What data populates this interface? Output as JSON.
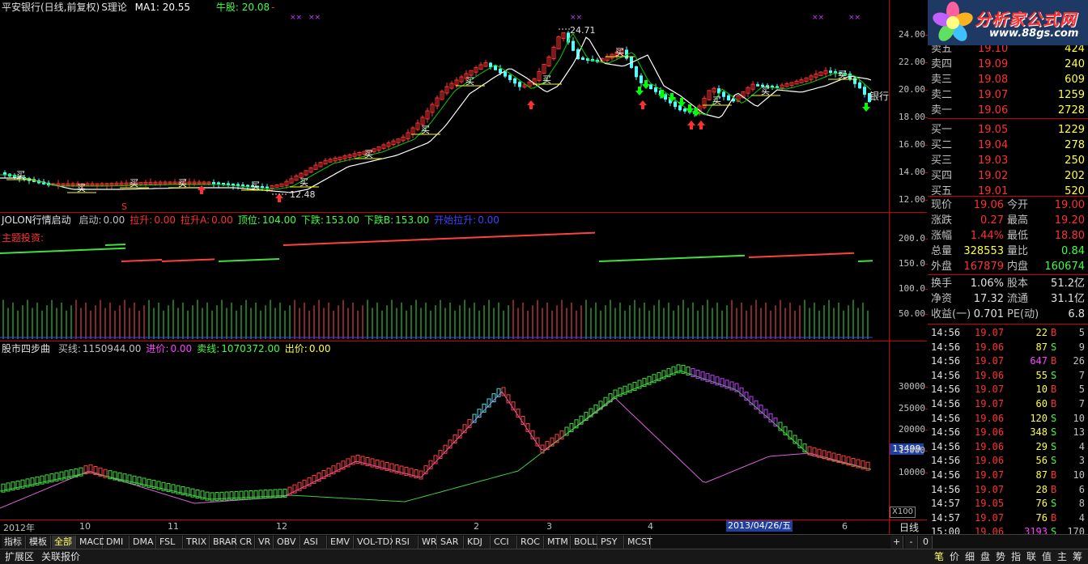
{
  "main_chart": {
    "title": "平安银行(日线,前复权)",
    "theory": "S理论",
    "ma1": "MA1: 20.55",
    "bull": "牛股: 20.08",
    "bull_suffix": "-",
    "high_label": "24.71",
    "low_label": "12.48",
    "side_label": "银行",
    "buy_marker": "买",
    "s_marker": "S",
    "axis_ticks": [
      "24.00",
      "22.00",
      "20.00",
      "18.00",
      "16.00",
      "14.00",
      "12.00"
    ],
    "colors": {
      "up": "#ff3232",
      "down": "#54fcfc",
      "ma": "#ffffff",
      "ma2": "#00cc00",
      "buy": "#ffff00",
      "arrow_up": "#ff3030",
      "arrow_down": "#00ff00"
    }
  },
  "indicator1": {
    "name": "JOLON行情启动",
    "fields": [
      {
        "label": "启动:",
        "value": "0.00",
        "color": "#c0c0c0"
      },
      {
        "label": "拉升:",
        "value": "0.00",
        "color": "#ff3030"
      },
      {
        "label": "拉升A:",
        "value": "0.00",
        "color": "#ff3030"
      },
      {
        "label": "顶位:",
        "value": "104.00",
        "color": "#40ff40"
      },
      {
        "label": "下跌:",
        "value": "153.00",
        "color": "#40ff40"
      },
      {
        "label": "下跌B:",
        "value": "153.00",
        "color": "#40ff40"
      },
      {
        "label": "开始拉升:",
        "value": "0.00",
        "color": "#4040ff"
      }
    ],
    "sub_label": "主题投资:",
    "axis_ticks": [
      "200.0",
      "150.0",
      "100.0",
      "50.00"
    ]
  },
  "indicator2": {
    "name": "股市四步曲",
    "fields": [
      {
        "label": "买线:",
        "value": "1150944.00",
        "color": "#c0c0c0"
      },
      {
        "label": "进价:",
        "value": "0.00",
        "color": "#ff40ff"
      },
      {
        "label": "卖线:",
        "value": "1070372.00",
        "color": "#40ff40"
      },
      {
        "label": "出价:",
        "value": "0.00",
        "color": "#ffff40"
      }
    ],
    "axis_ticks": [
      "30000",
      "25000",
      "20000",
      "15000",
      "10000"
    ],
    "current_value": "13499",
    "scale": "X100"
  },
  "x_axis": {
    "labels": [
      "2012年",
      "10",
      "11",
      "12",
      "2",
      "3",
      "4",
      "6"
    ],
    "highlight": "2013/04/26/五",
    "period": "日线"
  },
  "tabs": [
    "指标",
    "模板",
    "全部",
    "MACD",
    "DMI",
    "DMA",
    "FSL",
    "TRIX",
    "BRAR",
    "CR",
    "VR",
    "OBV",
    "ASI",
    "EMV",
    "VOL-TDX",
    "RSI",
    "WR",
    "SAR",
    "KDJ",
    "CCI",
    "ROC",
    "MTM",
    "BOLL",
    "PSY",
    "MCST"
  ],
  "tab_controls": [
    "+",
    "-",
    "0"
  ],
  "bottom_tabs": [
    "扩展区",
    "关联报价"
  ],
  "bottom_right_tabs": [
    "笔",
    "价",
    "细",
    "盘",
    "势",
    "指",
    "联",
    "值",
    "主",
    "筹"
  ],
  "logo": {
    "text": "分析家公式网",
    "url": "www.88gs.com"
  },
  "order_book": {
    "sell": [
      {
        "label": "卖五",
        "price": "19.10",
        "vol": "424"
      },
      {
        "label": "卖四",
        "price": "19.09",
        "vol": "240"
      },
      {
        "label": "卖三",
        "price": "19.08",
        "vol": "609"
      },
      {
        "label": "卖二",
        "price": "19.07",
        "vol": "1259"
      },
      {
        "label": "卖一",
        "price": "19.06",
        "vol": "2728"
      }
    ],
    "buy": [
      {
        "label": "买一",
        "price": "19.05",
        "vol": "1229"
      },
      {
        "label": "买二",
        "price": "19.04",
        "vol": "278"
      },
      {
        "label": "买三",
        "price": "19.03",
        "vol": "250"
      },
      {
        "label": "买四",
        "price": "19.02",
        "vol": "202"
      },
      {
        "label": "买五",
        "price": "19.01",
        "vol": "520"
      }
    ]
  },
  "quote": [
    {
      "l1": "现价",
      "v1": "19.06",
      "c1": "#ff3030",
      "l2": "今开",
      "v2": "19.00",
      "c2": "#ff3030"
    },
    {
      "l1": "涨跌",
      "v1": "0.27",
      "c1": "#ff3030",
      "l2": "最高",
      "v2": "19.20",
      "c2": "#ff3030"
    },
    {
      "l1": "涨幅",
      "v1": "1.44%",
      "c1": "#ff3030",
      "l2": "最低",
      "v2": "18.80",
      "c2": "#ff3030"
    },
    {
      "l1": "总量",
      "v1": "328553",
      "c1": "#ffff40",
      "l2": "量比",
      "v2": "0.84",
      "c2": "#40ff40"
    },
    {
      "l1": "外盘",
      "v1": "167879",
      "c1": "#ff3030",
      "l2": "内盘",
      "v2": "160674",
      "c2": "#40ff40"
    }
  ],
  "fundamentals": [
    {
      "l1": "换手",
      "v1": "1.06%",
      "l2": "股本",
      "v2": "51.2亿"
    },
    {
      "l1": "净资",
      "v1": "17.32",
      "l2": "流通",
      "v2": "31.1亿"
    },
    {
      "l1": "收益(一)",
      "v1": "0.701",
      "l2": "PE(动)",
      "v2": "6.8"
    }
  ],
  "ticks": [
    {
      "time": "14:56",
      "price": "19.07",
      "vol": "22",
      "bs": "B",
      "n": "5",
      "vc": "#ffff40"
    },
    {
      "time": "14:56",
      "price": "19.06",
      "vol": "87",
      "bs": "S",
      "n": "9",
      "vc": "#ffff40"
    },
    {
      "time": "14:56",
      "price": "19.07",
      "vol": "647",
      "bs": "B",
      "n": "26",
      "vc": "#ff40ff"
    },
    {
      "time": "14:56",
      "price": "19.06",
      "vol": "55",
      "bs": "S",
      "n": "7",
      "vc": "#ffff40"
    },
    {
      "time": "14:56",
      "price": "19.07",
      "vol": "10",
      "bs": "B",
      "n": "5",
      "vc": "#ffff40"
    },
    {
      "time": "14:56",
      "price": "19.07",
      "vol": "60",
      "bs": "B",
      "n": "7",
      "vc": "#ffff40"
    },
    {
      "time": "14:56",
      "price": "19.06",
      "vol": "120",
      "bs": "S",
      "n": "10",
      "vc": "#ffff40"
    },
    {
      "time": "14:56",
      "price": "19.06",
      "vol": "348",
      "bs": "S",
      "n": "13",
      "vc": "#ffff40"
    },
    {
      "time": "14:56",
      "price": "19.06",
      "vol": "29",
      "bs": "S",
      "n": "4",
      "vc": "#ffff40"
    },
    {
      "time": "14:56",
      "price": "19.06",
      "vol": "56",
      "bs": "S",
      "n": "3",
      "vc": "#ffff40"
    },
    {
      "time": "14:56",
      "price": "19.07",
      "vol": "87",
      "bs": "B",
      "n": "10",
      "vc": "#ffff40"
    },
    {
      "time": "14:56",
      "price": "19.07",
      "vol": "28",
      "bs": "B",
      "n": "6",
      "vc": "#ffff40"
    },
    {
      "time": "14:57",
      "price": "19.05",
      "vol": "76",
      "bs": "S",
      "n": "8",
      "vc": "#ffff40"
    },
    {
      "time": "14:57",
      "price": "19.07",
      "vol": "76",
      "bs": "B",
      "n": "4",
      "vc": "#ffff40"
    },
    {
      "time": "15:00",
      "price": "19.06",
      "vol": "3193",
      "bs": "S",
      "n": "170",
      "vc": "#ff40ff"
    }
  ]
}
